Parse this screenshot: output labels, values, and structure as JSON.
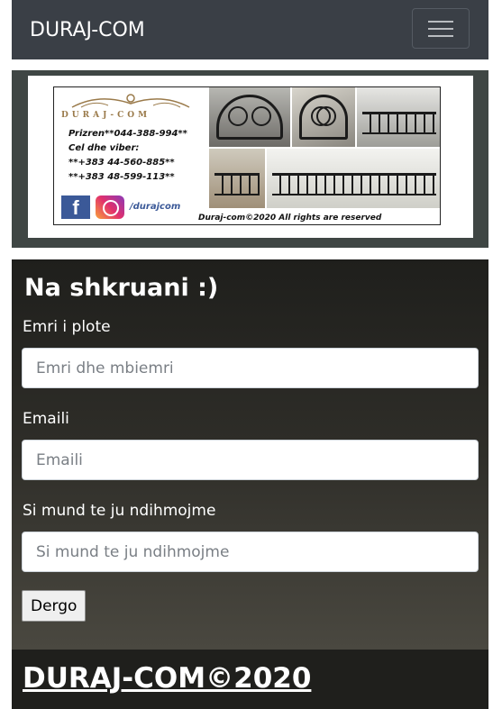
{
  "navbar": {
    "brand": "DURAJ-COM",
    "toggle_icon": "hamburger-menu-icon"
  },
  "banner": {
    "logo_text": "DURAJ-COM",
    "contact_lines": [
      "Prizren**044-388-994**",
      "Cel dhe viber:",
      "**+383 44-560-885**",
      "**+383 48-599-113**"
    ],
    "social_icons": [
      "facebook-icon",
      "instagram-icon"
    ],
    "handle": "/durajcom",
    "copyright": "Duraj-com©2020 All rights are reserved"
  },
  "contact_form": {
    "title": "Na shkruani :)",
    "name_label": "Emri i plote",
    "name_placeholder": "Emri dhe mbiemri",
    "email_label": "Emaili",
    "email_placeholder": "Emaili",
    "message_label": "Si mund te ju ndihmojme",
    "message_placeholder": "Si mund te ju ndihmojme",
    "submit_label": "Dergo"
  },
  "footer": {
    "title": "DURAJ-COM©2020"
  },
  "colors": {
    "navbar_bg": "#3a3f46",
    "form_bg": "#2f2e29",
    "text_light": "#ffffff"
  }
}
